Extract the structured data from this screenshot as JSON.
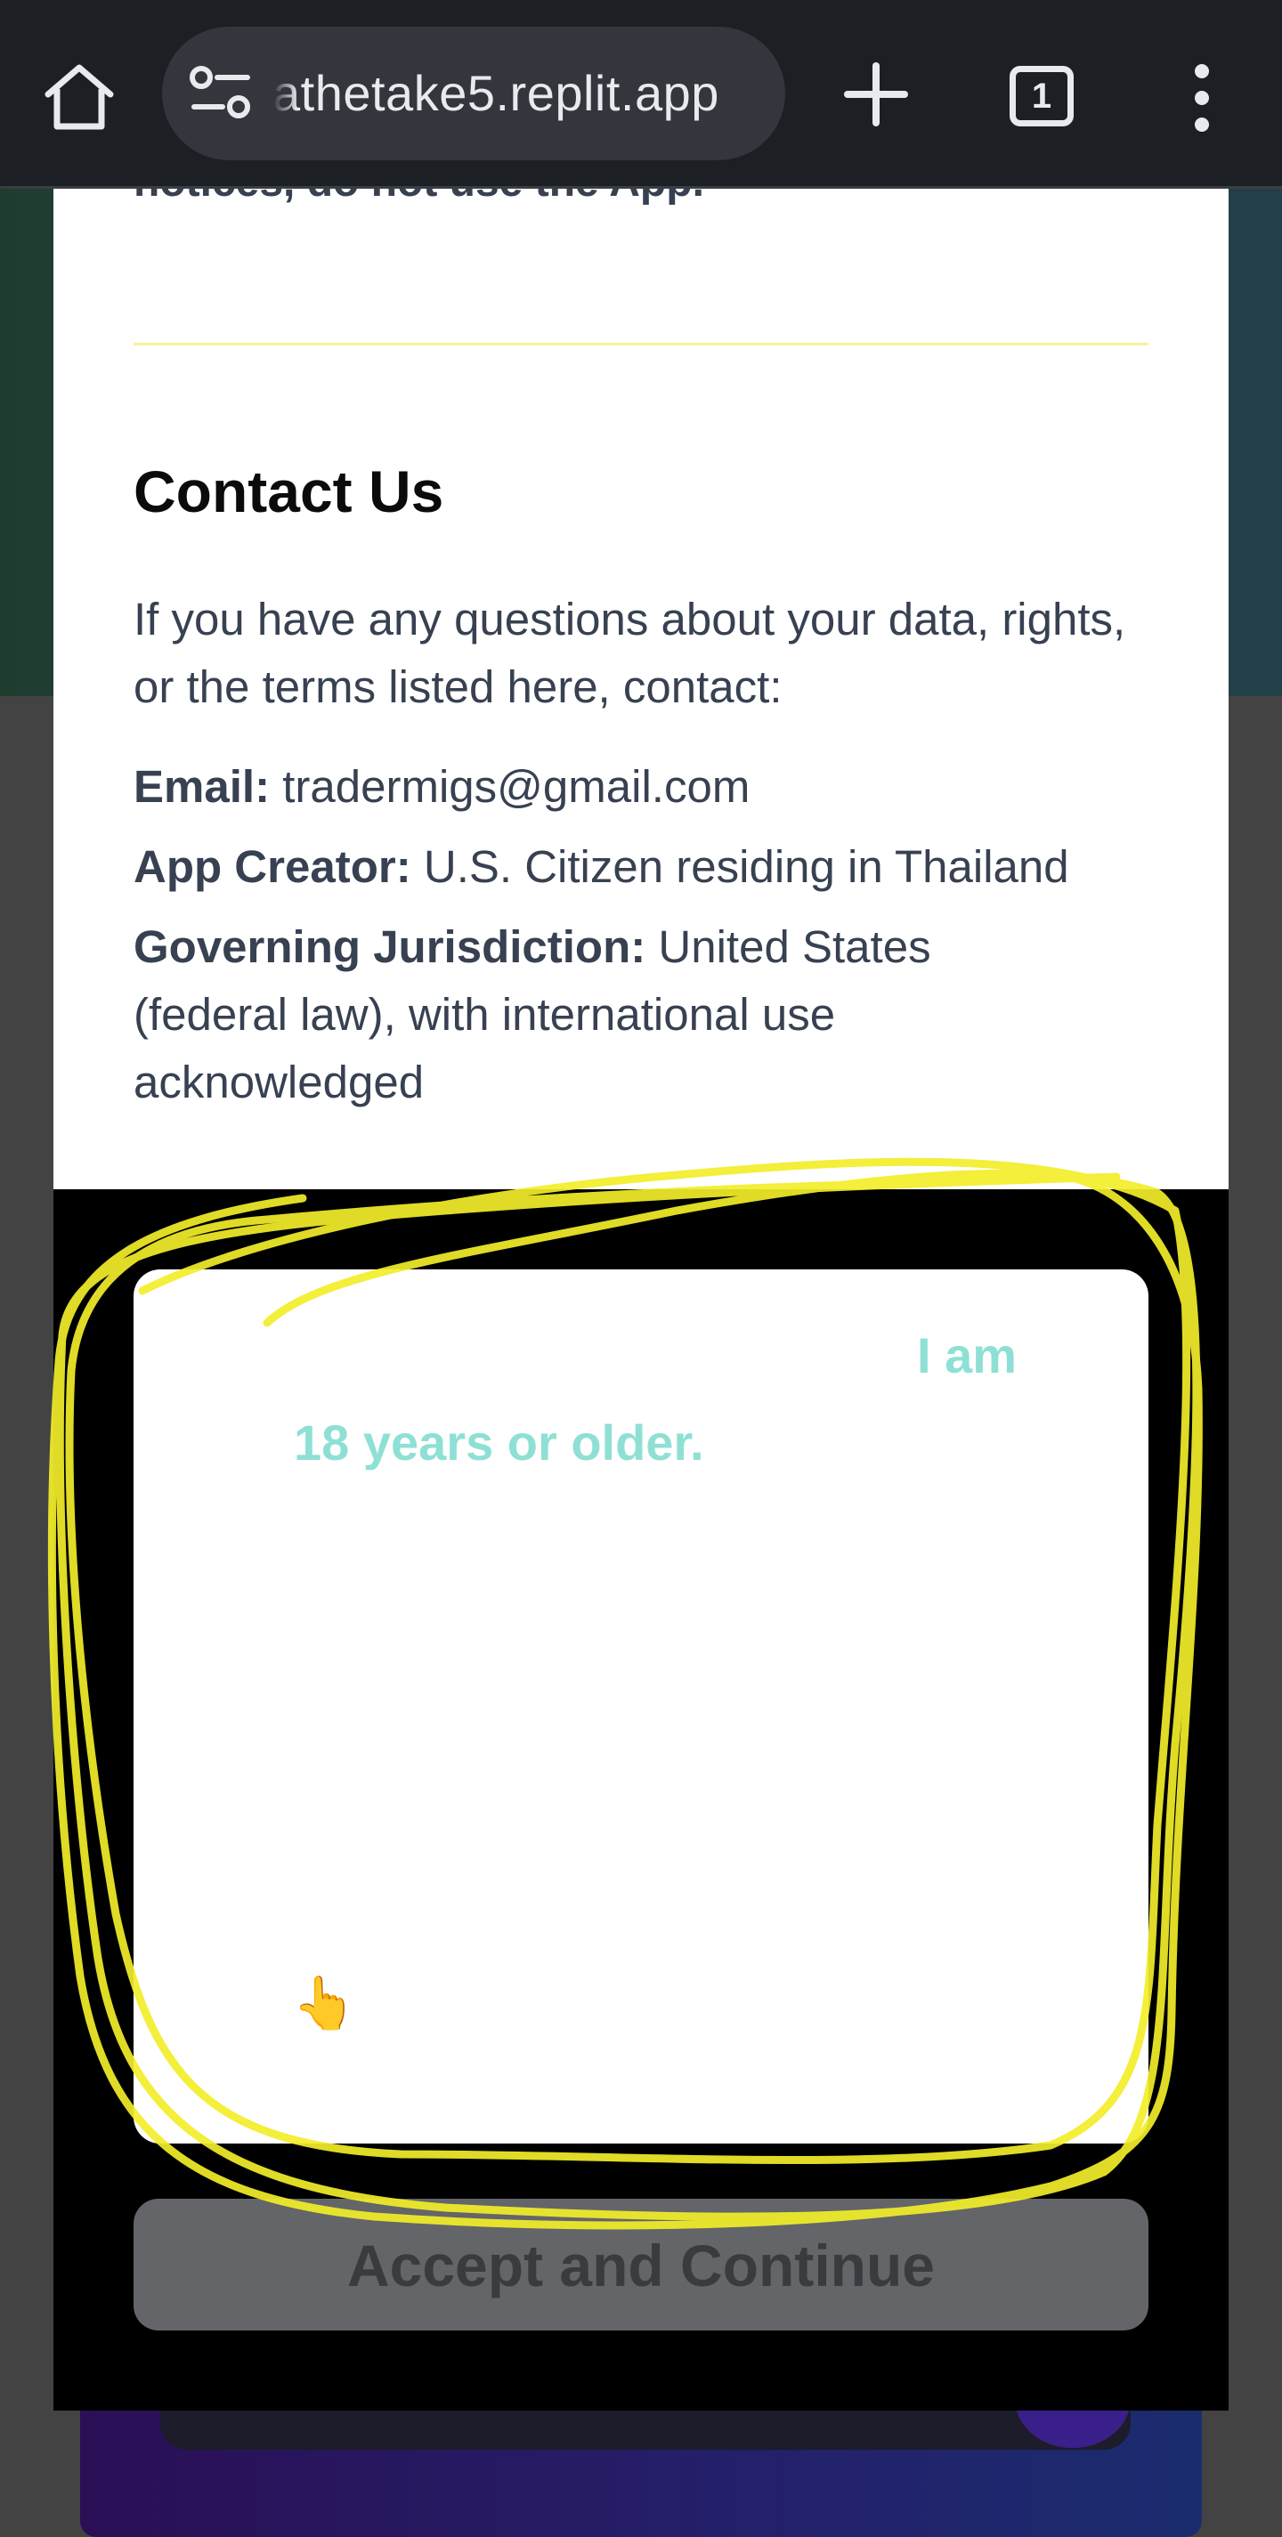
{
  "browser": {
    "url": "athetake5.replit.app",
    "tab_count": "1",
    "home_icon": "home-icon",
    "site_settings_icon": "site-settings-icon",
    "new_tab_icon": "plus-icon",
    "menu_icon": "more-vert-icon"
  },
  "modal": {
    "notice_tail": "notices, do not use the App.",
    "contact": {
      "heading": "Contact Us",
      "intro": "If you have any questions about your data, rights, or the terms listed here, contact:",
      "email_label": "Email:",
      "email_value": "tradermigs@gmail.com",
      "creator_label": "App Creator:",
      "creator_value": "U.S. Citizen residing in Thailand",
      "jurisdiction_label": "Governing Jurisdiction:",
      "jurisdiction_value": "United States (federal law), with international use acknowledged"
    },
    "consent": {
      "age_text_part1": "I am",
      "age_text_part2": "18 years or older.",
      "pointer_icon": "pointing-hand-icon"
    },
    "accept_button": "Accept and Continue"
  },
  "colors": {
    "browser_bar": "#1c1f24",
    "url_pill": "#33363c",
    "accent_teal": "#8fe0d4",
    "divider_yellow": "#f5f59a",
    "highlighter": "#f2ee2a",
    "button_disabled": "#646569"
  }
}
